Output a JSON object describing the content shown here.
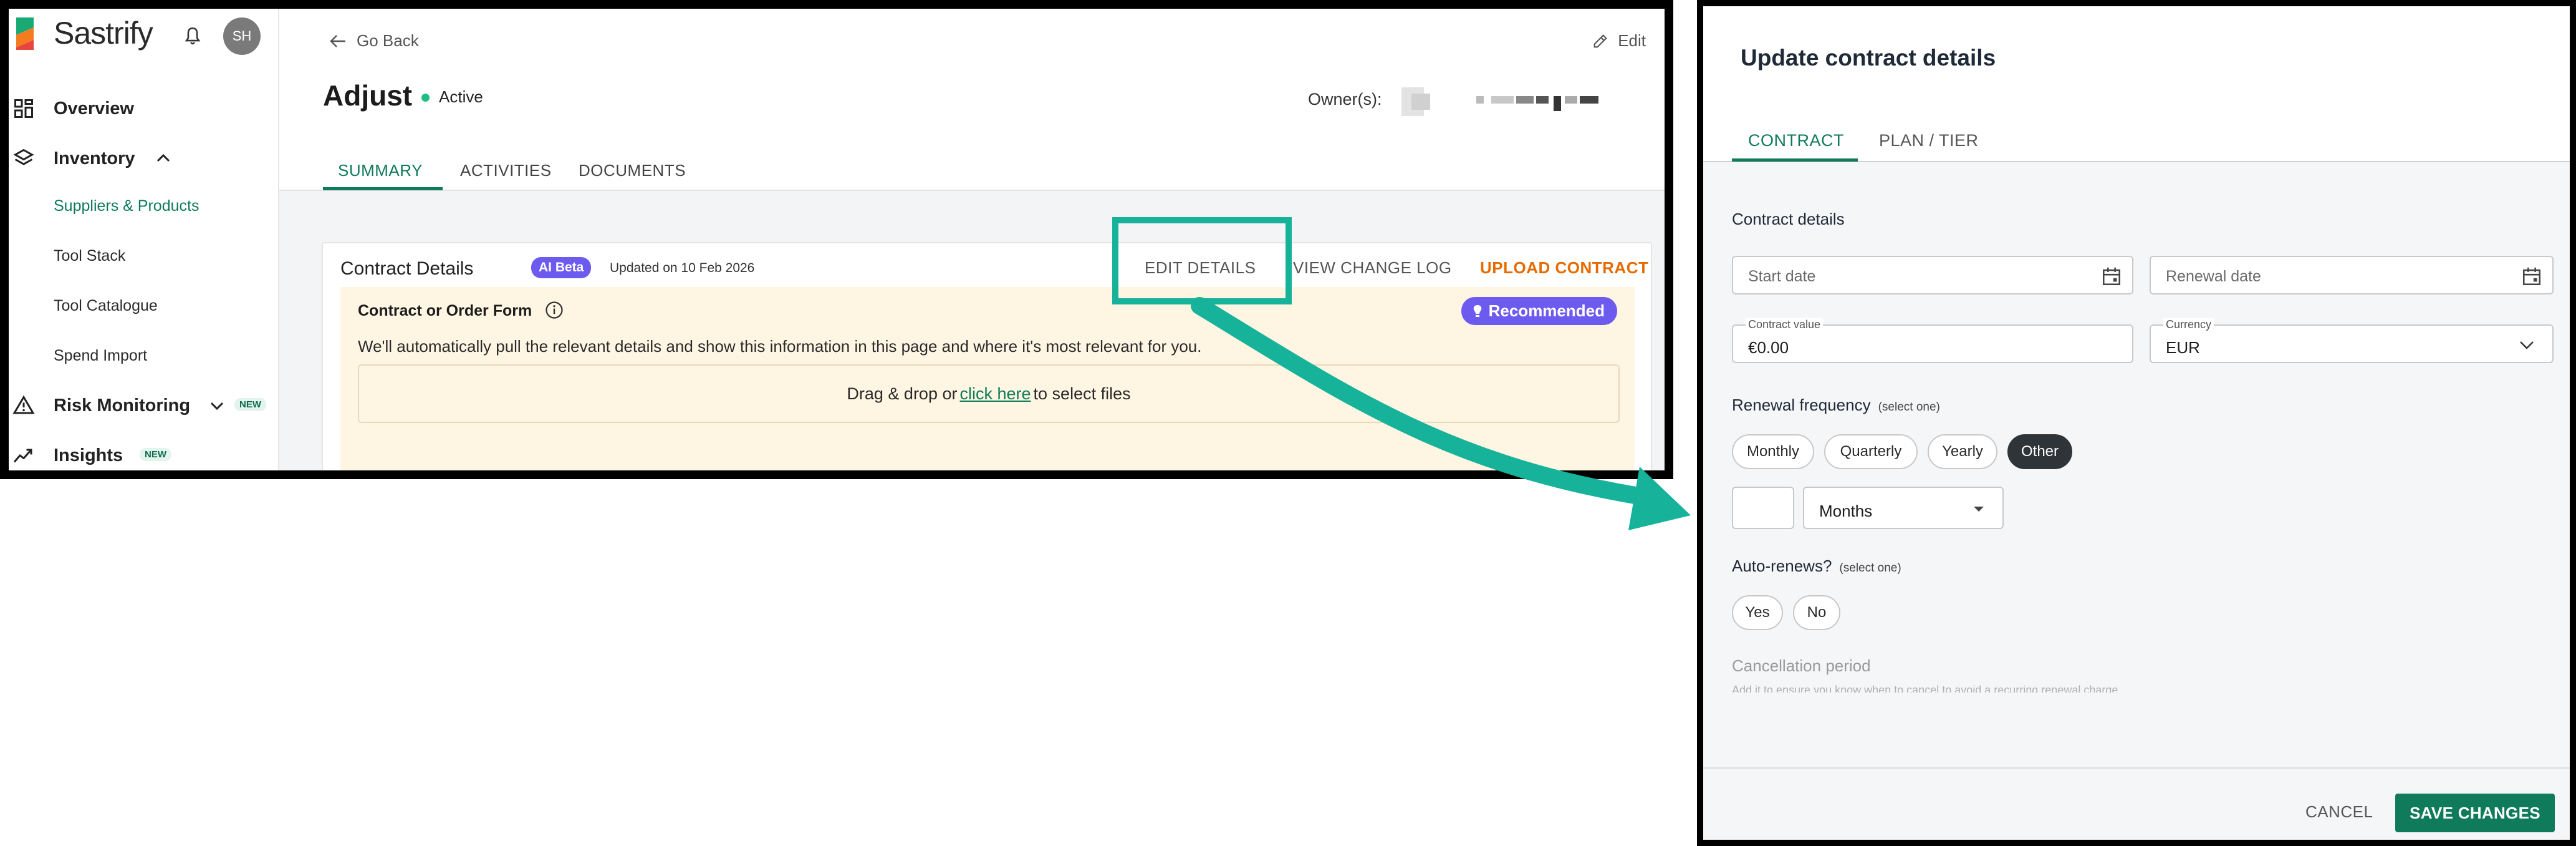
{
  "colors": {
    "brand_green": "#0f7b5a",
    "accent_purple": "#6d5bf0",
    "upload_orange": "#e66a00",
    "highlight_teal": "#16b39a",
    "status_active": "#1fbf84",
    "recommended_bg": "#fff5e3"
  },
  "sidebar": {
    "brand": "Sastrify",
    "avatar_initials": "SH",
    "items": [
      {
        "label": "Overview",
        "icon": "grid-icon"
      },
      {
        "label": "Inventory",
        "icon": "layers-icon"
      },
      {
        "label": "Risk Monitoring",
        "icon": "warning-icon",
        "badge": "NEW"
      },
      {
        "label": "Insights",
        "icon": "trend-icon",
        "badge": "NEW"
      }
    ],
    "sub_items": [
      "Suppliers & Products",
      "Tool Stack",
      "Tool Catalogue",
      "Spend Import"
    ]
  },
  "header": {
    "go_back": "Go Back",
    "edit": "Edit",
    "title": "Adjust",
    "status": "Active",
    "owners_label": "Owner(s):",
    "tabs": [
      "SUMMARY",
      "ACTIVITIES",
      "DOCUMENTS"
    ]
  },
  "contract_card": {
    "title": "Contract Details",
    "ai_badge": "AI Beta",
    "updated": "Updated on 10 Feb 2026",
    "actions": {
      "edit_details": "EDIT DETAILS",
      "view_change_log": "VIEW CHANGE LOG",
      "upload_contract": "UPLOAD CONTRACT"
    },
    "form_title": "Contract or Order Form",
    "recommended": "Recommended",
    "description": "We'll automatically pull the relevant details and show this information in this page and where it's most relevant for you.",
    "drop_prefix": "Drag & drop or",
    "drop_link": "click here",
    "drop_suffix": "to select files"
  },
  "dialog": {
    "title": "Update contract details",
    "tabs": [
      "CONTRACT",
      "PLAN / TIER"
    ],
    "section_contract": "Contract details",
    "start_date_placeholder": "Start date",
    "renewal_date_placeholder": "Renewal date",
    "contract_value_label": "Contract value",
    "contract_value": "€0.00",
    "currency_label": "Currency",
    "currency_value": "EUR",
    "renewal_frequency_label": "Renewal frequency",
    "select_one_hint": "(select one)",
    "renewal_options": [
      "Monthly",
      "Quarterly",
      "Yearly",
      "Other"
    ],
    "renewal_selected": "Other",
    "period_unit": "Months",
    "auto_renews_label": "Auto-renews?",
    "auto_renews_options": [
      "Yes",
      "No"
    ],
    "cancellation_label": "Cancellation period",
    "cancellation_hint": "Add it to ensure you know when to cancel to avoid a recurring renewal charge",
    "cancel_button": "CANCEL",
    "save_button": "SAVE CHANGES"
  }
}
